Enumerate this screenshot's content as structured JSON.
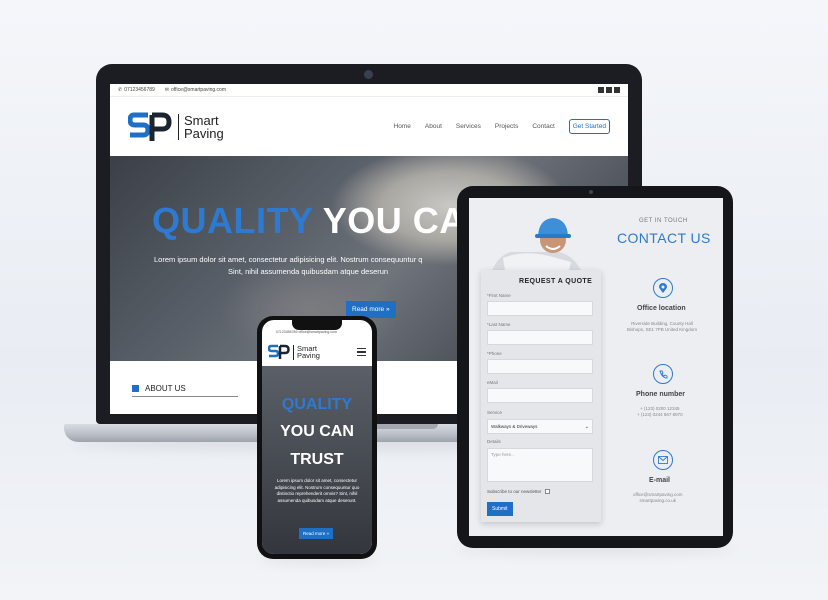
{
  "laptop": {
    "topbar": {
      "phone": "07123456789",
      "email": "office@smartpaving.com"
    },
    "logo": {
      "line1": "Smart",
      "line2": "Paving"
    },
    "nav": [
      "Home",
      "About",
      "Services",
      "Projects",
      "Contact"
    ],
    "cta": "Get Started",
    "hero": {
      "title_blue": "QUALITY",
      "title_white": " YOU CAN",
      "line1": "Lorem ipsum dolor sit amet, consectetur adipisicing elit. Nostrum consequuntur q",
      "line2": "Sint, nihil assumenda quibusdam atque deserun",
      "button": "Read more »"
    },
    "about": "ABOUT US"
  },
  "tablet": {
    "form": {
      "title": "REQUEST A QUOTE",
      "labels": [
        "*First Name",
        "*Last Name",
        "*Phone",
        "eMail",
        "Service",
        "Details"
      ],
      "service_value": "Walkways & Driveways",
      "details_placeholder": "Type here...",
      "subscribe": "Subscribe to our newsletter",
      "submit": "Submit"
    },
    "get_in_touch": "GET IN TOUCH",
    "contact_title": "CONTACT US",
    "office": {
      "heading": "Office location",
      "line1": "Riverside Building, County Hall",
      "line2": "Bishops, SE1 7PB United Kingdom"
    },
    "phone": {
      "heading": "Phone number",
      "line1": "+ (123) 0200 12345",
      "line2": "+ (123) 0244 567 8970"
    },
    "email": {
      "heading": "E-mail",
      "line1": "office@smartpaving.com",
      "line2": "smartpaving.co.uk"
    }
  },
  "phone": {
    "topbar": "07123456789  office@smartpaving.com",
    "logo": {
      "line1": "Smart",
      "line2": "Paving"
    },
    "hero": {
      "line1": "QUALITY",
      "line2": "YOU CAN",
      "line3": "TRUST",
      "text": "Lorem ipsum dolor sit amet, consectetur adipisicing elit. Nostrum consequuntur quo distinctio reprehenderit omnis? Sint, nihil assumenda quibusdam atque deserunt.",
      "button": "Read more »"
    }
  },
  "colors": {
    "brand_blue": "#1f6fc4",
    "title_blue": "#2e7ad1"
  }
}
